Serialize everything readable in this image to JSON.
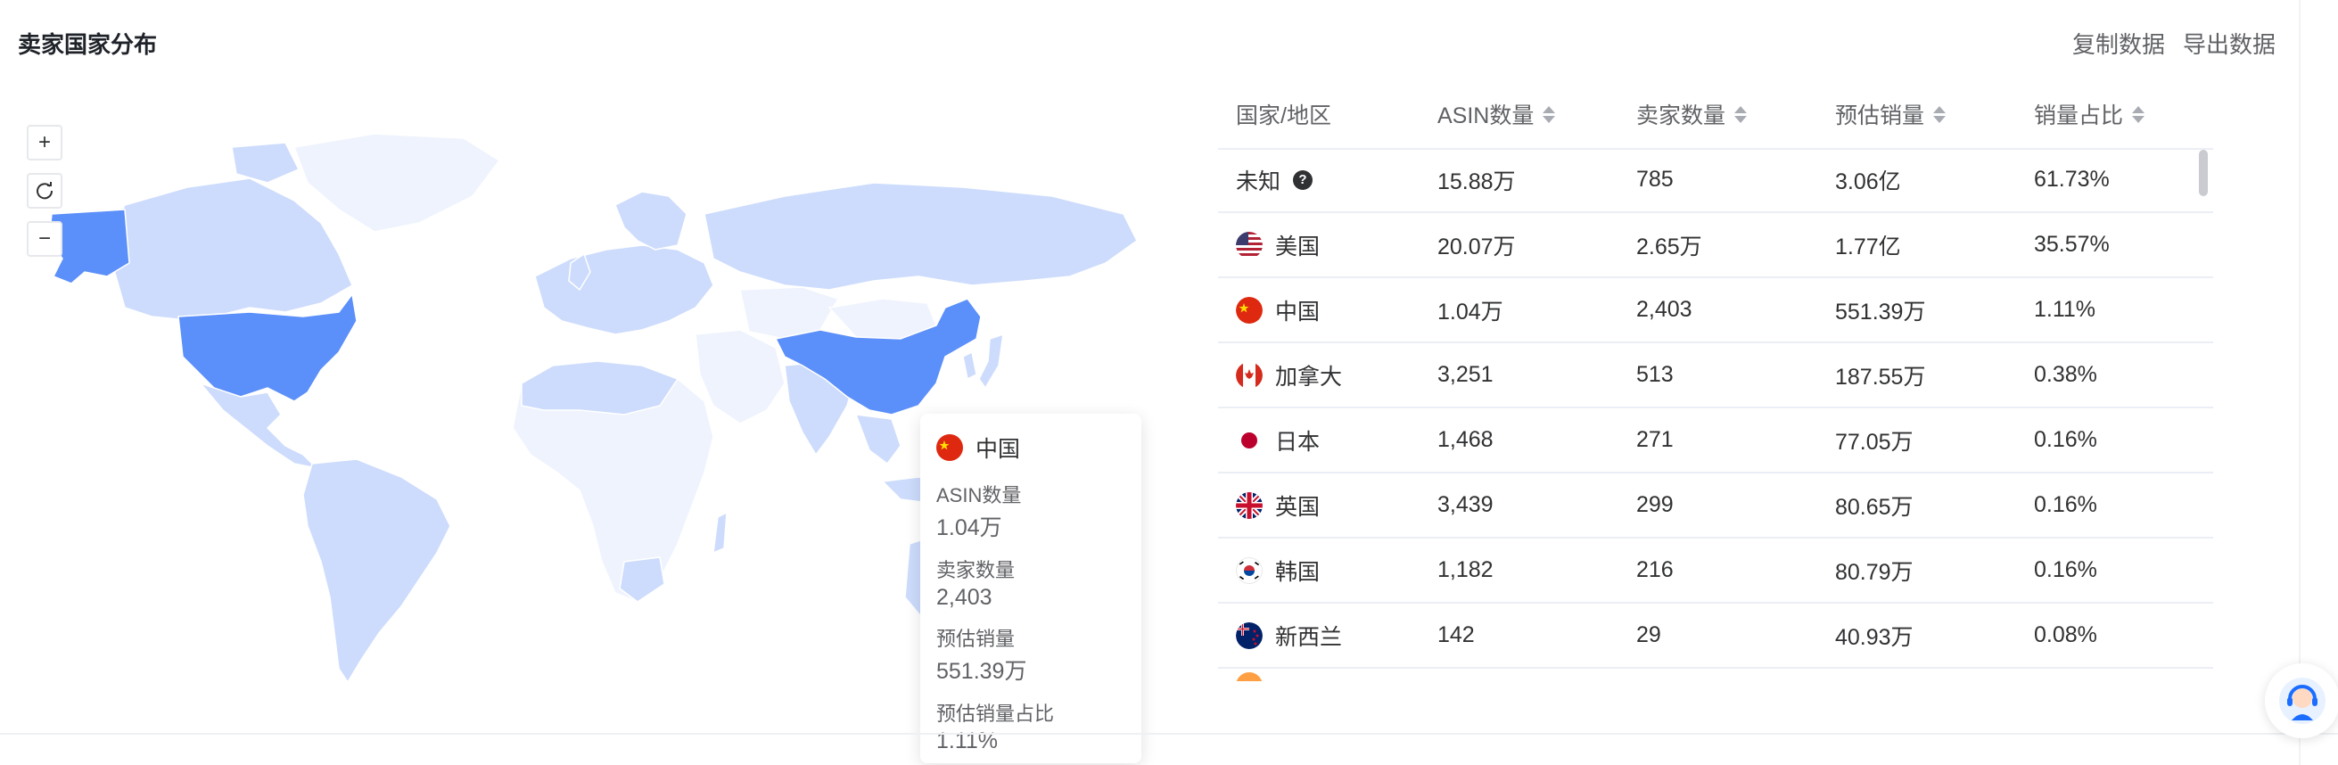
{
  "panel": {
    "title": "卖家国家分布"
  },
  "actions": {
    "copy": "复制数据",
    "export": "导出数据"
  },
  "map_controls": {
    "zoom_in": "+",
    "reset_icon": "refresh-icon",
    "zoom_out": "−"
  },
  "colors": {
    "highlight": "#5b8ff9",
    "medium": "#cddcfc",
    "light": "#eff3fd",
    "neutral": "#f5f7fa"
  },
  "tooltip": {
    "country": "中国",
    "items": [
      {
        "label": "ASIN数量",
        "value": "1.04万"
      },
      {
        "label": "卖家数量",
        "value": "2,403"
      },
      {
        "label": "预估销量",
        "value": "551.39万"
      },
      {
        "label": "预估销量占比",
        "value": "1.11%"
      }
    ]
  },
  "table": {
    "headers": [
      "国家/地区",
      "ASIN数量",
      "卖家数量",
      "预估销量",
      "销量占比"
    ],
    "rows": [
      {
        "country": "未知",
        "flag": "unknown",
        "asin": "15.88万",
        "sellers": "785",
        "sales": "3.06亿",
        "share": "61.73%"
      },
      {
        "country": "美国",
        "flag": "us",
        "asin": "20.07万",
        "sellers": "2.65万",
        "sales": "1.77亿",
        "share": "35.57%"
      },
      {
        "country": "中国",
        "flag": "cn",
        "asin": "1.04万",
        "sellers": "2,403",
        "sales": "551.39万",
        "share": "1.11%"
      },
      {
        "country": "加拿大",
        "flag": "ca",
        "asin": "3,251",
        "sellers": "513",
        "sales": "187.55万",
        "share": "0.38%"
      },
      {
        "country": "日本",
        "flag": "jp",
        "asin": "1,468",
        "sellers": "271",
        "sales": "77.05万",
        "share": "0.16%"
      },
      {
        "country": "英国",
        "flag": "gb",
        "asin": "3,439",
        "sellers": "299",
        "sales": "80.65万",
        "share": "0.16%"
      },
      {
        "country": "韩国",
        "flag": "kr",
        "asin": "1,182",
        "sellers": "216",
        "sales": "80.79万",
        "share": "0.16%"
      },
      {
        "country": "新西兰",
        "flag": "nz",
        "asin": "142",
        "sellers": "29",
        "sales": "40.93万",
        "share": "0.08%"
      }
    ]
  },
  "support": {
    "icon": "customer-service-icon"
  }
}
